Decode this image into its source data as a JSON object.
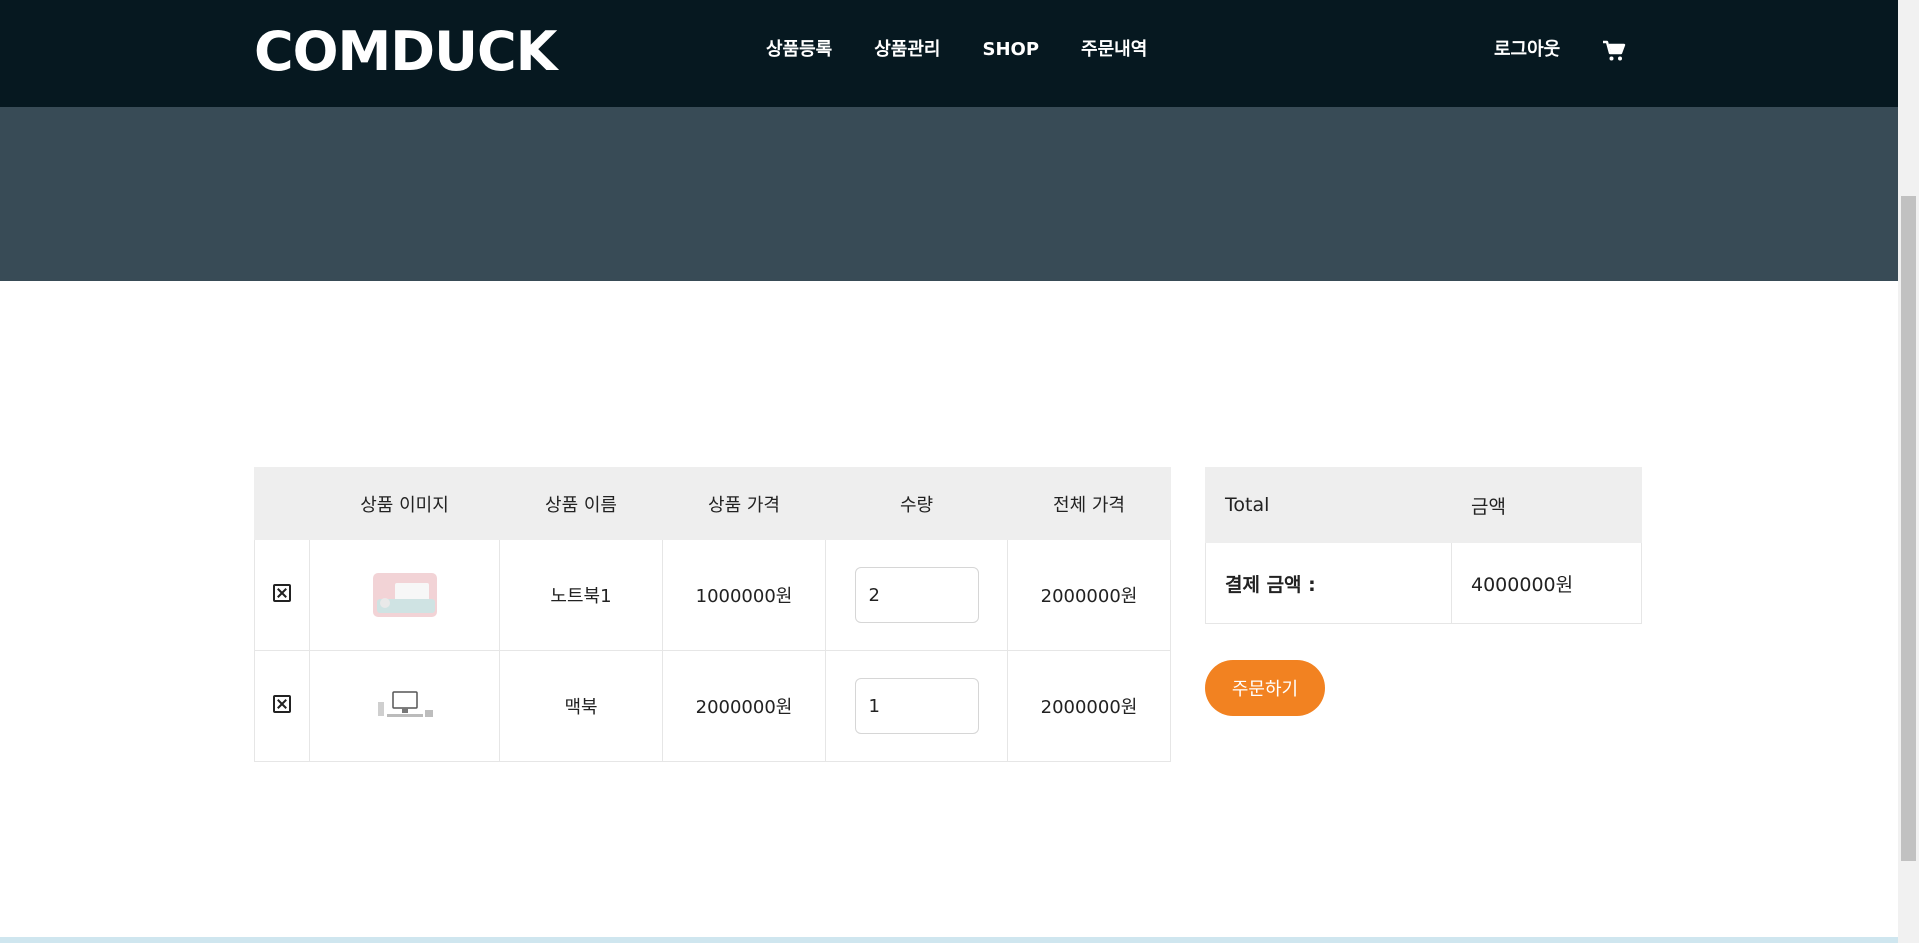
{
  "header": {
    "logo": "COMDUCK",
    "nav": [
      "상품등록",
      "상품관리",
      "SHOP",
      "주문내역"
    ],
    "logout": "로그아웃",
    "cart_icon": "shopping-cart-icon"
  },
  "cart": {
    "headers": [
      "",
      "상품 이미지",
      "상품 이름",
      "상품 가격",
      "수량",
      "전체 가격"
    ],
    "rows": [
      {
        "name": "노트북1",
        "price": "1000000원",
        "qty": "2",
        "total": "2000000원"
      },
      {
        "name": "맥북",
        "price": "2000000원",
        "qty": "1",
        "total": "2000000원"
      }
    ]
  },
  "summary": {
    "col1": "Total",
    "col2": "금액",
    "label": "결제 금액 :",
    "amount": "4000000원",
    "order_button": "주문하기"
  },
  "colors": {
    "header_bg": "#061820",
    "hero_bg": "#384b56",
    "accent": "#f28221"
  }
}
